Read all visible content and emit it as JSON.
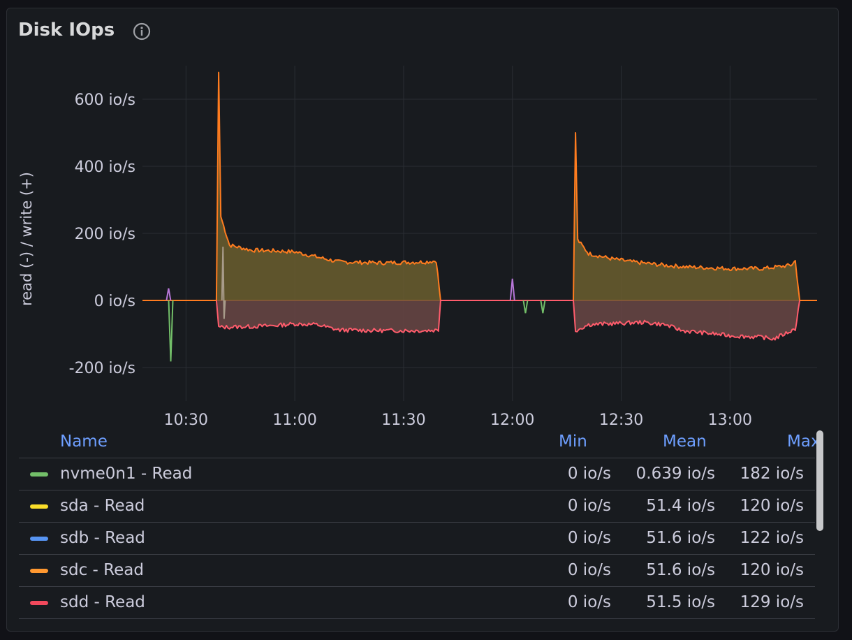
{
  "panel": {
    "title": "Disk IOps"
  },
  "chart_data": {
    "type": "line",
    "ylabel": "read (-) / write (+)",
    "y_unit": "io/s",
    "y_ticks": [
      "600 io/s",
      "400 io/s",
      "200 io/s",
      "0 io/s",
      "-200 io/s"
    ],
    "x_ticks": [
      "10:30",
      "11:00",
      "11:30",
      "12:00",
      "12:30",
      "13:00"
    ],
    "ylim": [
      -300,
      700
    ],
    "x_range_minutes": [
      10.3,
      13.4
    ],
    "grid": true,
    "write_envelope": [
      [
        10.64,
        0
      ],
      [
        10.65,
        680
      ],
      [
        10.66,
        250
      ],
      [
        10.7,
        165
      ],
      [
        10.8,
        150
      ],
      [
        10.9,
        148
      ],
      [
        11.0,
        145
      ],
      [
        11.1,
        130
      ],
      [
        11.2,
        115
      ],
      [
        11.4,
        112
      ],
      [
        11.6,
        115
      ],
      [
        11.65,
        118
      ],
      [
        11.67,
        0
      ],
      [
        12.28,
        0
      ],
      [
        12.29,
        500
      ],
      [
        12.3,
        180
      ],
      [
        12.35,
        140
      ],
      [
        12.45,
        125
      ],
      [
        12.55,
        115
      ],
      [
        12.7,
        105
      ],
      [
        12.8,
        100
      ],
      [
        13.0,
        95
      ],
      [
        13.15,
        95
      ],
      [
        13.28,
        105
      ],
      [
        13.3,
        118
      ],
      [
        13.32,
        0
      ]
    ],
    "read_envelope": [
      [
        10.64,
        0
      ],
      [
        10.65,
        -80
      ],
      [
        10.8,
        -78
      ],
      [
        10.9,
        -75
      ],
      [
        11.0,
        -70
      ],
      [
        11.1,
        -72
      ],
      [
        11.2,
        -88
      ],
      [
        11.4,
        -90
      ],
      [
        11.6,
        -90
      ],
      [
        11.66,
        -88
      ],
      [
        11.67,
        0
      ],
      [
        12.28,
        0
      ],
      [
        12.29,
        -90
      ],
      [
        12.35,
        -72
      ],
      [
        12.5,
        -68
      ],
      [
        12.6,
        -65
      ],
      [
        12.7,
        -72
      ],
      [
        12.78,
        -90
      ],
      [
        12.9,
        -98
      ],
      [
        13.0,
        -105
      ],
      [
        13.15,
        -110
      ],
      [
        13.2,
        -115
      ],
      [
        13.25,
        -100
      ],
      [
        13.3,
        -85
      ],
      [
        13.32,
        0
      ]
    ],
    "spikes": [
      {
        "series": "nvme0n1 - Read",
        "x": 10.43,
        "y": -182
      },
      {
        "series": "nvme0n1 - Write",
        "x": 10.42,
        "y": 36
      },
      {
        "series": "nvme0n1 - Write",
        "x": 12.0,
        "y": 65
      },
      {
        "series": "nvme0n1 - Read",
        "x": 12.06,
        "y": -38
      },
      {
        "series": "nvme0n1 - Read",
        "x": 12.14,
        "y": -38
      }
    ],
    "series": [
      {
        "name": "nvme0n1 - Read",
        "color": "#73bf69",
        "min": "0 io/s",
        "mean": "0.639 io/s",
        "max": "182 io/s"
      },
      {
        "name": "sda - Read",
        "color": "#fade2a",
        "min": "0 io/s",
        "mean": "51.4 io/s",
        "max": "120 io/s"
      },
      {
        "name": "sdb - Read",
        "color": "#5794f2",
        "min": "0 io/s",
        "mean": "51.6 io/s",
        "max": "122 io/s"
      },
      {
        "name": "sdc - Read",
        "color": "#ff9830",
        "min": "0 io/s",
        "mean": "51.6 io/s",
        "max": "120 io/s"
      },
      {
        "name": "sdd - Read",
        "color": "#f2495c",
        "min": "0 io/s",
        "mean": "51.5 io/s",
        "max": "129 io/s"
      }
    ]
  },
  "legend": {
    "headers": {
      "name": "Name",
      "min": "Min",
      "mean": "Mean",
      "max": "Max"
    }
  },
  "colors": {
    "write_line": "#ff7c1f",
    "write_fill": "#6b5e2f",
    "read_line": "#ff5c6c",
    "read_fill": "#6a4645",
    "grid": "#2a2d33",
    "axis_text": "#ccccdc"
  }
}
